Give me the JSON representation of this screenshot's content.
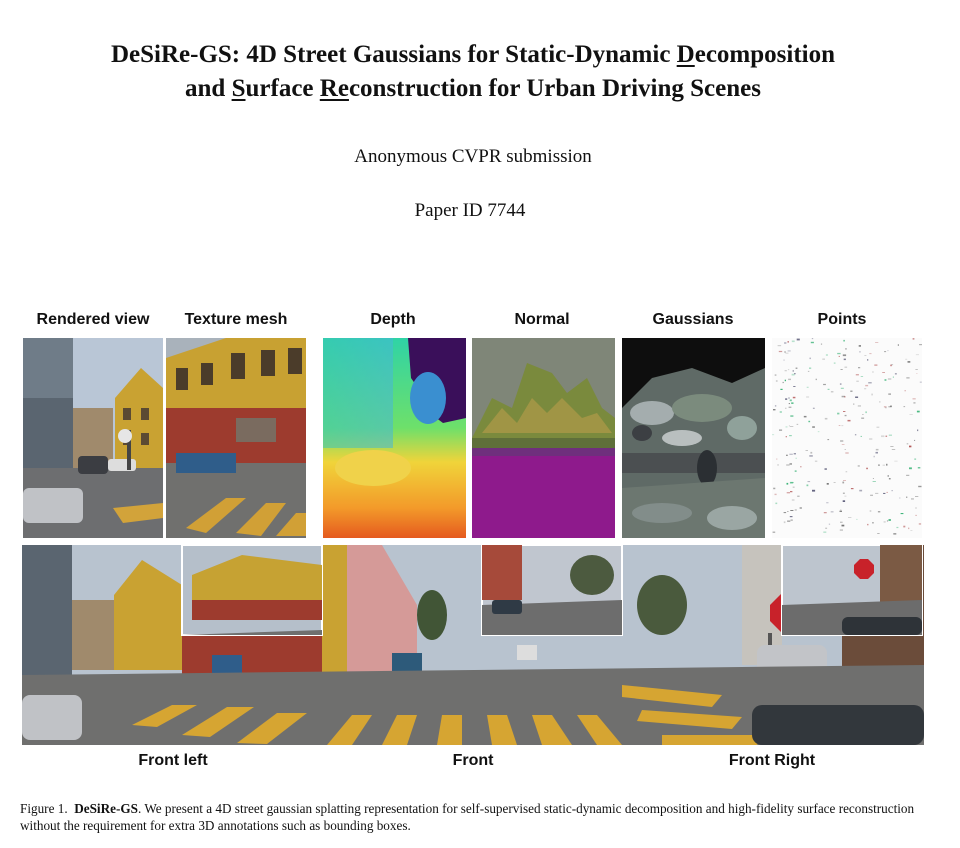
{
  "paper": {
    "title_part1": "DeSiRe-GS: 4D Street Gaussians for Static-Dynamic ",
    "title_D": "D",
    "title_ecomposition": "ecomposition",
    "title_and": "and ",
    "title_S": "S",
    "title_urface": "urface ",
    "title_Re": "Re",
    "title_rest": "construction for Urban Driving Scenes",
    "author": "Anonymous CVPR submission",
    "paper_id": "Paper ID 7744"
  },
  "figure": {
    "columns": [
      "Rendered view",
      "Texture mesh",
      "Depth",
      "Normal",
      "Gaussians",
      "Points"
    ],
    "rows": [
      "Front left",
      "Front",
      "Front Right"
    ],
    "caption_prefix": "Figure 1.",
    "caption_name": "DeSiRe-GS",
    "caption_text": ". We present a 4D street gaussian splatting representation for self-supervised static-dynamic decomposition and high-fidelity surface reconstruction without the requirement for extra 3D annotations such as bounding boxes."
  }
}
